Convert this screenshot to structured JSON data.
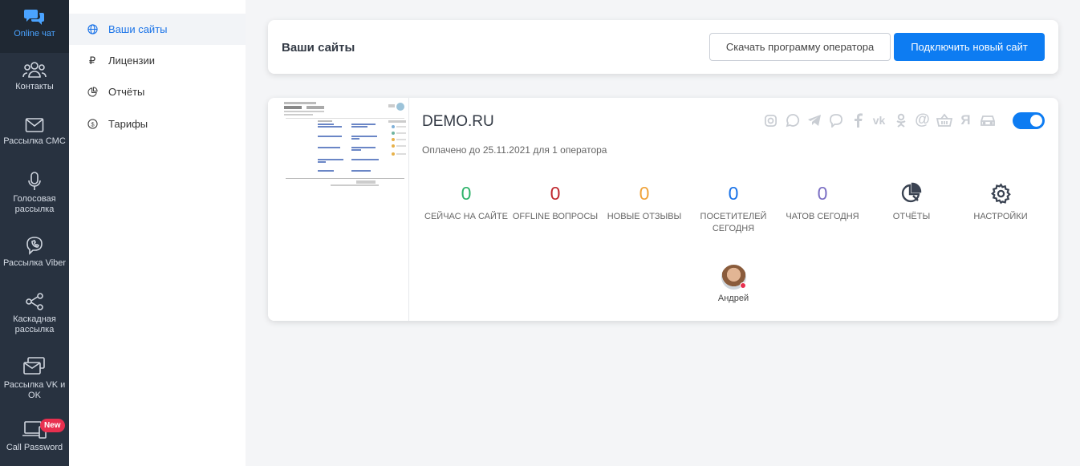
{
  "rail": {
    "items": [
      {
        "label": "Online чат",
        "icon": "chat-bubbles-icon",
        "active": true
      },
      {
        "label": "Контакты",
        "icon": "contacts-icon"
      },
      {
        "label": "Рассылка СМС",
        "icon": "envelope-icon"
      },
      {
        "label": "Голосовая рассылка",
        "icon": "microphone-icon"
      },
      {
        "label": "Рассылка Viber",
        "icon": "viber-icon"
      },
      {
        "label": "Каскадная рассылка",
        "icon": "share-icon"
      },
      {
        "label": "Рассылка VK и OK",
        "icon": "vk-ok-mail-icon"
      },
      {
        "label": "Call Password",
        "icon": "devices-icon",
        "badge": "New"
      }
    ]
  },
  "subnav": {
    "items": [
      {
        "label": "Ваши сайты",
        "icon": "globe-icon",
        "active": true
      },
      {
        "label": "Лицензии",
        "icon": "ruble-icon"
      },
      {
        "label": "Отчёты",
        "icon": "pie-chart-icon"
      },
      {
        "label": "Тарифы",
        "icon": "dollar-circle-icon"
      }
    ]
  },
  "header": {
    "title": "Ваши сайты",
    "download_button": "Скачать программу оператора",
    "connect_button": "Подключить новый сайт"
  },
  "site": {
    "name": "DEMO.RU",
    "paid_until": "Оплачено до 25.11.2021 для 1 оператора",
    "enabled": true,
    "channels": [
      "instagram-icon",
      "whatsapp-icon",
      "telegram-icon",
      "viber-icon",
      "facebook-icon",
      "vk-icon",
      "odnoklassniki-icon",
      "email-at-icon",
      "basket-icon",
      "yandex-icon",
      "car-icon"
    ],
    "stats": [
      {
        "value": "0",
        "label": "СЕЙЧАС НА САЙТЕ",
        "color": "#2fb36b"
      },
      {
        "value": "0",
        "label": "OFFLINE ВОПРОСЫ",
        "color": "#c0282f"
      },
      {
        "value": "0",
        "label": "НОВЫЕ ОТЗЫВЫ",
        "color": "#f0a33a"
      },
      {
        "value": "0",
        "label": "ПОСЕТИТЕЛЕЙ СЕГОДНЯ",
        "color": "#1a73e8"
      },
      {
        "value": "0",
        "label": "ЧАТОВ СЕГОДНЯ",
        "color": "#7b6fc4"
      }
    ],
    "reports_label": "ОТЧЁТЫ",
    "settings_label": "НАСТРОЙКИ",
    "operator_name": "Андрей"
  },
  "colors": {
    "accent": "#0d7cf2",
    "rail_bg": "#283240",
    "active_link": "#1a73e8"
  }
}
